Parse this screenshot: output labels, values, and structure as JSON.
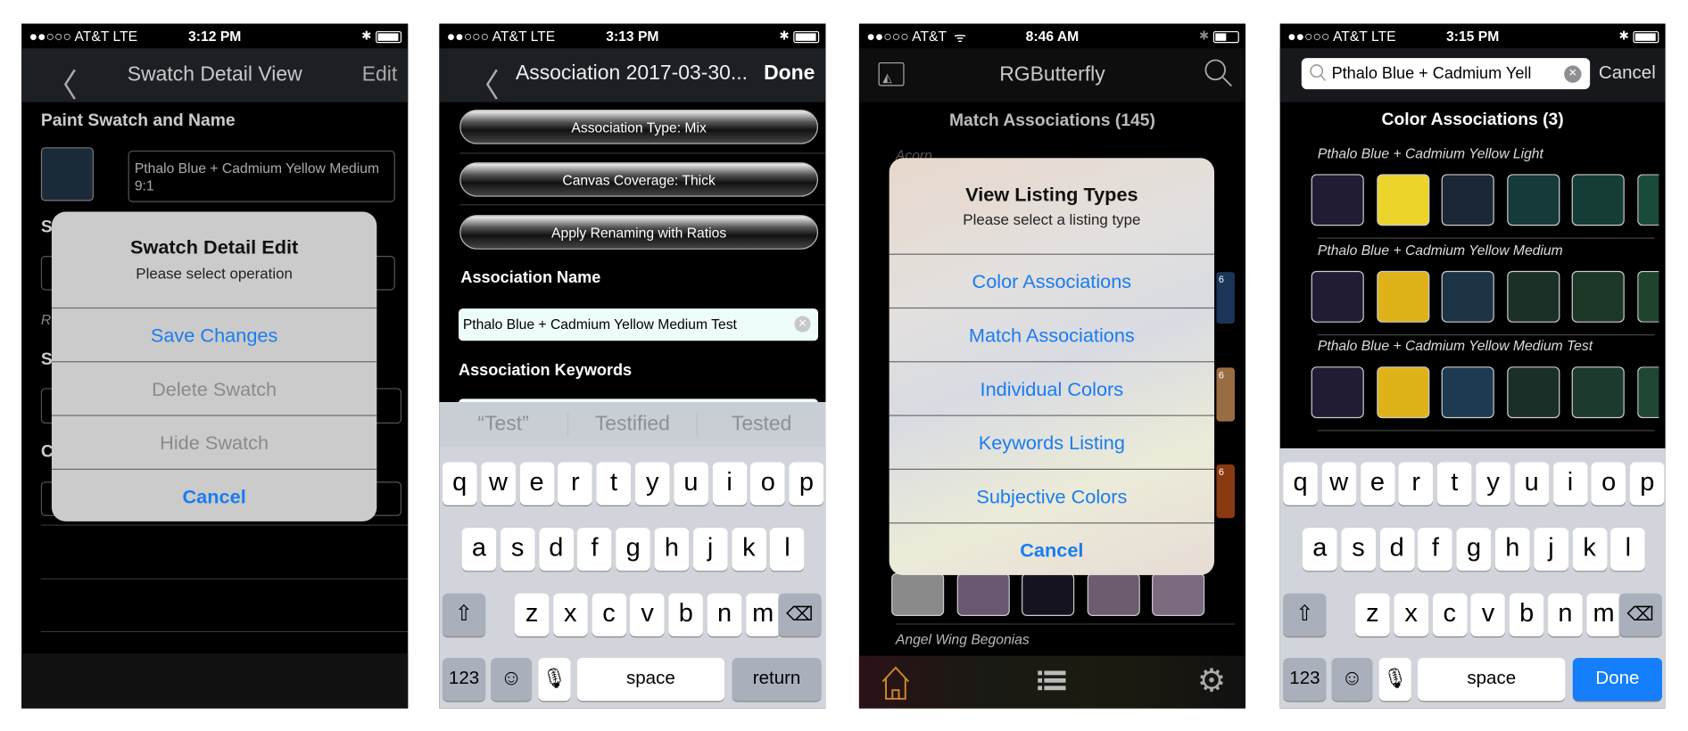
{
  "colors": {
    "ios_blue": "#1a7cf0",
    "nav_bg": "#1c1f24",
    "keyboard_bg": "#d1d5db",
    "done_blue": "#147efb",
    "home_orange": "#d08a2a"
  },
  "screen1": {
    "status": {
      "carrier": "●●○○○ AT&T  LTE",
      "time": "3:12 PM"
    },
    "nav": {
      "title": "Swatch Detail View",
      "edit": "Edit"
    },
    "section_title": "Paint Swatch and Name",
    "swatch_color": "#1b2a38",
    "name_field": "Pthalo Blue + Cadmium Yellow Medium 9:1",
    "partial_labels": [
      "S",
      "R",
      "S",
      "C"
    ],
    "alert": {
      "title": "Swatch Detail Edit",
      "message": "Please select operation",
      "actions": [
        "Save Changes",
        "Delete Swatch",
        "Hide Swatch",
        "Cancel"
      ]
    }
  },
  "screen2": {
    "status": {
      "carrier": "●●○○○ AT&T  LTE",
      "time": "3:13 PM"
    },
    "nav": {
      "title": "Association 2017-03-30...",
      "done": "Done"
    },
    "buttons": [
      "Association Type: Mix",
      "Canvas Coverage: Thick",
      "Apply Renaming with Ratios"
    ],
    "name_label": "Association Name",
    "name_value": "Pthalo Blue + Cadmium Yellow Medium Test",
    "keywords_label": "Association Keywords",
    "suggestions": [
      "“Test”",
      "Testified",
      "Tested"
    ],
    "keyboard": {
      "row1": [
        "q",
        "w",
        "e",
        "r",
        "t",
        "y",
        "u",
        "i",
        "o",
        "p"
      ],
      "row2": [
        "a",
        "s",
        "d",
        "f",
        "g",
        "h",
        "j",
        "k",
        "l"
      ],
      "row3": [
        "z",
        "x",
        "c",
        "v",
        "b",
        "n",
        "m"
      ],
      "numbers": "123",
      "space": "space",
      "action": "return"
    }
  },
  "screen3": {
    "status": {
      "carrier": "●●○○○ AT&T",
      "time": "8:46 AM"
    },
    "nav": {
      "title": "RGButterfly"
    },
    "section_title": "Match Associations (145)",
    "first_item": "Acorn",
    "last_item": "Angel Wing Begonias",
    "alert": {
      "title": "View Listing Types",
      "message": "Please select a listing type",
      "actions": [
        "Color Associations",
        "Match Associations",
        "Individual Colors",
        "Keywords Listing",
        "Subjective Colors",
        "Cancel"
      ]
    },
    "swatch_colors": [
      "#8a8a8a",
      "#6a5870",
      "#15131d",
      "#6d5c70",
      "#7b6a80"
    ],
    "partial_badges": [
      "6",
      "6",
      "6"
    ],
    "tabs": [
      "home",
      "list",
      "settings"
    ]
  },
  "screen4": {
    "status": {
      "carrier": "●●○○○ AT&T  LTE",
      "time": "3:15 PM"
    },
    "search": {
      "value": "Pthalo Blue + Cadmium Yell",
      "cancel": "Cancel"
    },
    "section_title": "Color Associations (3)",
    "associations": [
      {
        "name": "Pthalo Blue + Cadmium Yellow Light",
        "colors": [
          "#231b33",
          "#ecd42a",
          "#1b2636",
          "#153a38",
          "#163c36",
          "#1a4a3a"
        ]
      },
      {
        "name": "Pthalo Blue + Cadmium Yellow Medium",
        "colors": [
          "#231b33",
          "#e0b21a",
          "#1d3346",
          "#1c3028",
          "#1c3628",
          "#1e4430"
        ]
      },
      {
        "name": "Pthalo Blue + Cadmium Yellow Medium Test",
        "colors": [
          "#231b33",
          "#e0b21a",
          "#1d3a50",
          "#1b2e28",
          "#1d3a2e",
          "#1f4634"
        ]
      }
    ],
    "keyboard": {
      "row1": [
        "q",
        "w",
        "e",
        "r",
        "t",
        "y",
        "u",
        "i",
        "o",
        "p"
      ],
      "row2": [
        "a",
        "s",
        "d",
        "f",
        "g",
        "h",
        "j",
        "k",
        "l"
      ],
      "row3": [
        "z",
        "x",
        "c",
        "v",
        "b",
        "n",
        "m"
      ],
      "numbers": "123",
      "space": "space",
      "action": "Done"
    }
  }
}
